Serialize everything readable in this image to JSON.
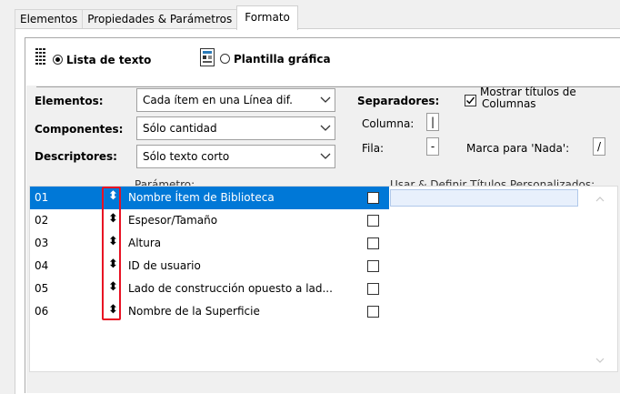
{
  "tabs": [
    "Elementos",
    "Propiedades & Parámetros",
    "Formato"
  ],
  "display_mode": {
    "text_list_label": "Lista de texto",
    "graphic_template_label": "Plantilla gráfica",
    "selected": "text_list"
  },
  "settings": {
    "elementos_label": "Elementos:",
    "elementos_value": "Cada ítem en una Línea dif.",
    "componentes_label": "Componentes:",
    "componentes_value": "Sólo cantidad",
    "descriptores_label": "Descriptores:",
    "descriptores_value": "Sólo texto corto"
  },
  "separators": {
    "title": "Separadores:",
    "column_label": "Columna:",
    "column_value": "|",
    "row_label": "Fila:",
    "row_value": "-",
    "nada_label": "Marca para 'Nada':",
    "nada_value": "/",
    "show_titles_line1": "Mostrar títulos de",
    "show_titles_line2": "Columnas",
    "show_titles_checked": true
  },
  "list": {
    "param_header": "Parámetro:",
    "custom_titles_header": "Usar & Definir Títulos Personalizados:",
    "rows": [
      {
        "num": "01",
        "name": "Nombre Ítem de Biblioteca"
      },
      {
        "num": "02",
        "name": "Espesor/Tamaño"
      },
      {
        "num": "03",
        "name": "Altura"
      },
      {
        "num": "04",
        "name": "ID de usuario"
      },
      {
        "num": "05",
        "name": "Lado de construcción opuesto a lad..."
      },
      {
        "num": "06",
        "name": "Nombre de la Superficie"
      }
    ],
    "move_glyph": "⬍",
    "selected_index": 0
  },
  "colors": {
    "selection": "#0078d7",
    "highlight_box": "#e81123"
  }
}
